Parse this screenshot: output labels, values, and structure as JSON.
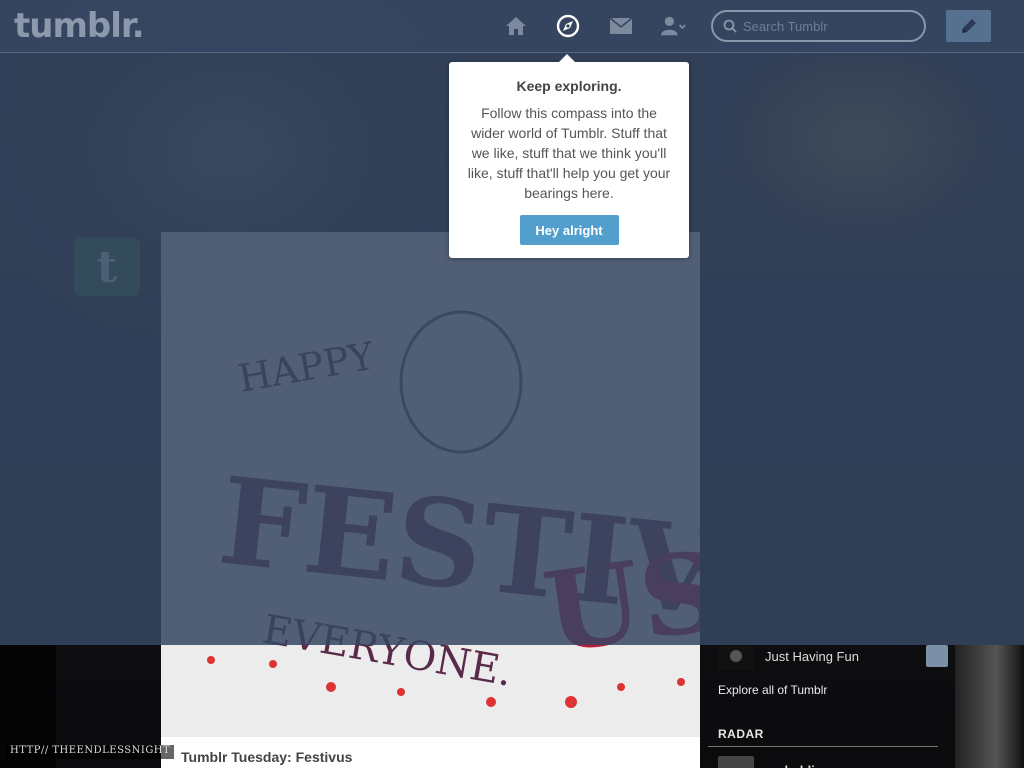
{
  "header": {
    "logo": "tumblr.",
    "search_placeholder": "Search Tumblr",
    "nav": {
      "home": "home-icon",
      "explore": "compass-icon",
      "inbox": "mail-icon",
      "account": "account-icon",
      "compose": "pencil-icon"
    }
  },
  "popover": {
    "title": "Keep exploring.",
    "body": "Follow this compass into the wider world of Tumblr. Stuff that we like, stuff that we think you'll like, stuff that'll help you get your bearings here.",
    "button": "Hey alright"
  },
  "post": {
    "title": "Tumblr Tuesday: Festivus"
  },
  "sidebar": {
    "recommended": [
      {
        "name": "Just Having Fun"
      }
    ],
    "explore_link": "Explore all of Tumblr",
    "radar_heading": "RADAR",
    "radar_user": "racheldinozzo"
  },
  "watermark": "HTTP// THEENDLESSNIGHT",
  "colors": {
    "overlay": "#364662",
    "accent_button": "#529ecc",
    "compose": "#56708f"
  }
}
